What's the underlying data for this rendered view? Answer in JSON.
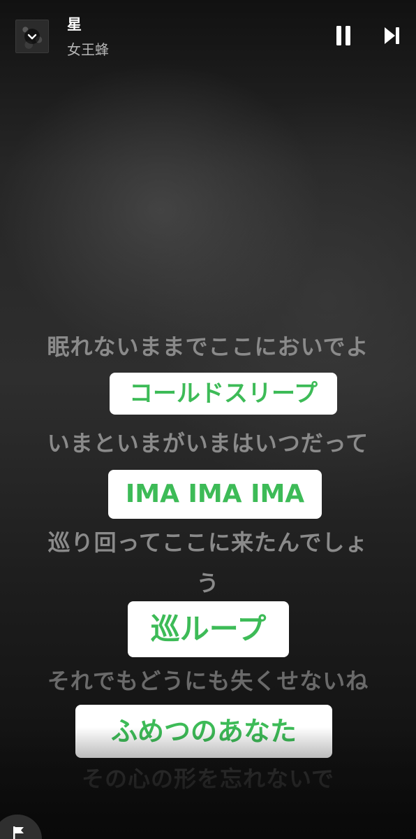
{
  "now_playing": {
    "title": "星",
    "artist": "女王蜂"
  },
  "controls": {
    "collapse_icon": "chevron-down-icon",
    "pause_icon": "pause-icon",
    "next_icon": "skip-next-icon",
    "report_icon": "flag-icon"
  },
  "lyrics": {
    "line1": "眠れないままでここにおいでよ",
    "chip1": "コールドスリープ",
    "line2": "いまといまがいまはいつだって",
    "chip2": "IMA IMA IMA",
    "line3a": "巡り回ってここに来たんでしょ",
    "line3b": "う",
    "chip3": "巡ループ",
    "line4": "それでもどうにも失くせないね",
    "chip4": "ふめつのあなた",
    "line5": "その心の形を忘れないで"
  },
  "colors": {
    "highlight_text": "#3dbb57",
    "highlight_bg": "#ffffff",
    "title": "#ffffff",
    "artist": "#b5b5b5"
  }
}
